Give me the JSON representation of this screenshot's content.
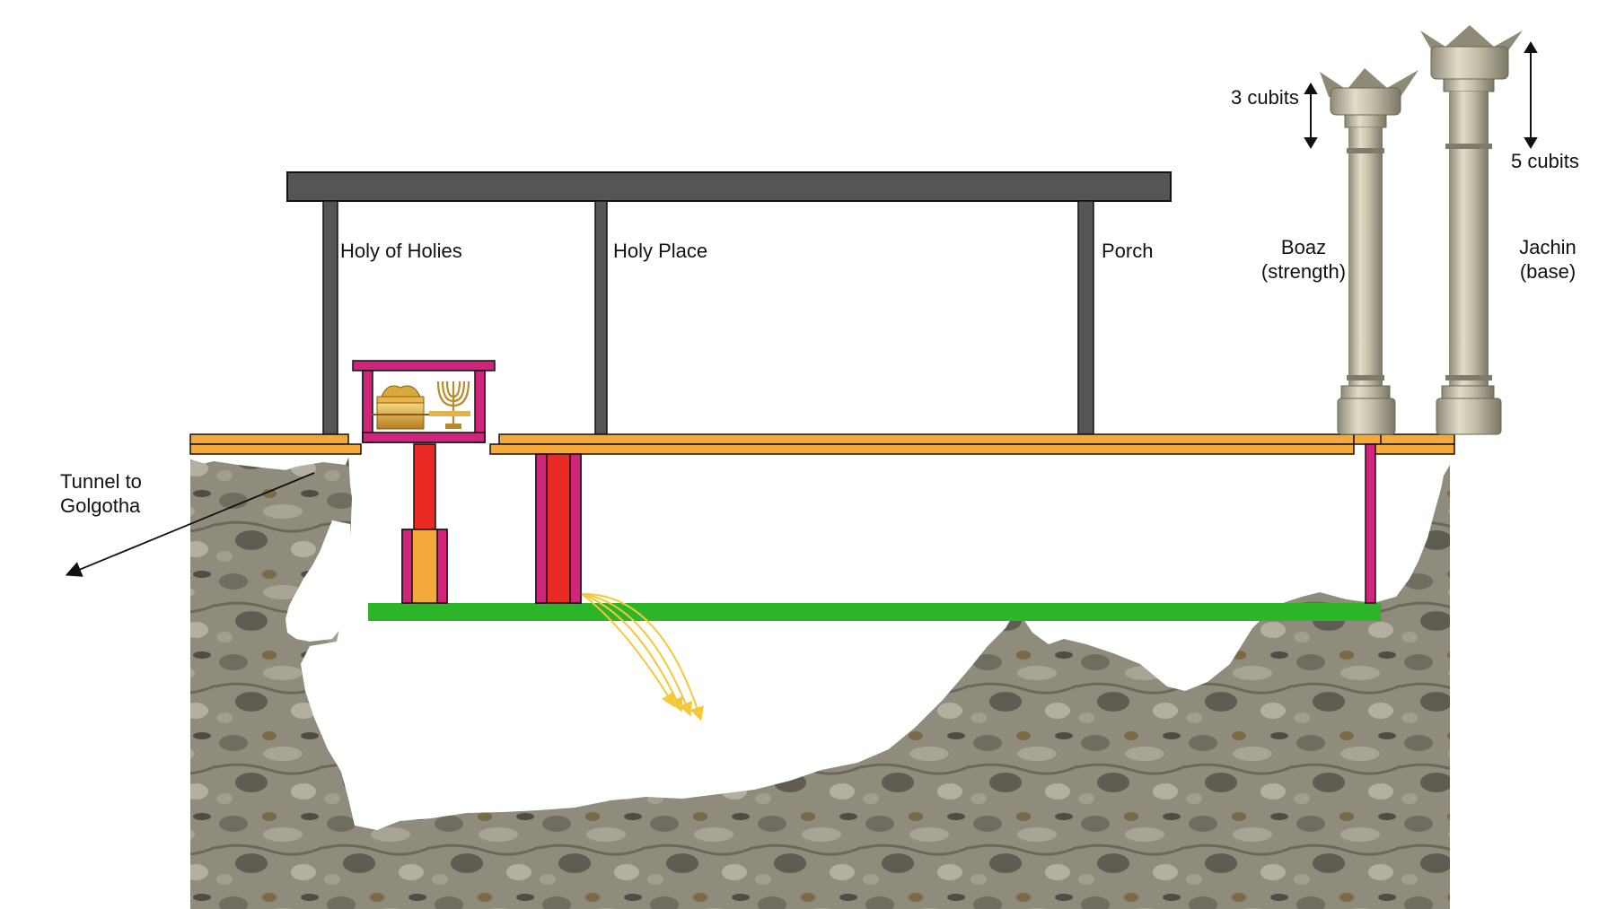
{
  "labels": {
    "holy_of_holies": "Holy of Holies",
    "holy_place": "Holy Place",
    "porch": "Porch",
    "boaz_name": "Boaz",
    "boaz_meaning": "(strength)",
    "jachin_name": "Jachin",
    "jachin_meaning": "(base)",
    "boaz_capital_height": "3 cubits",
    "jachin_capital_height": "5 cubits",
    "tunnel_line1": "Tunnel to",
    "tunnel_line2": "Golgotha"
  },
  "colors": {
    "roof": "#555555",
    "floor": "#f5a93a",
    "magenta": "#d0257a",
    "red": "#ea2a24",
    "green": "#2db52a",
    "rock": "#8a8779",
    "pillar": "#bdb8a4",
    "gold": "#f2c84b"
  },
  "icons": {
    "ark": "ark-of-covenant-icon",
    "menorah": "menorah-icon"
  }
}
